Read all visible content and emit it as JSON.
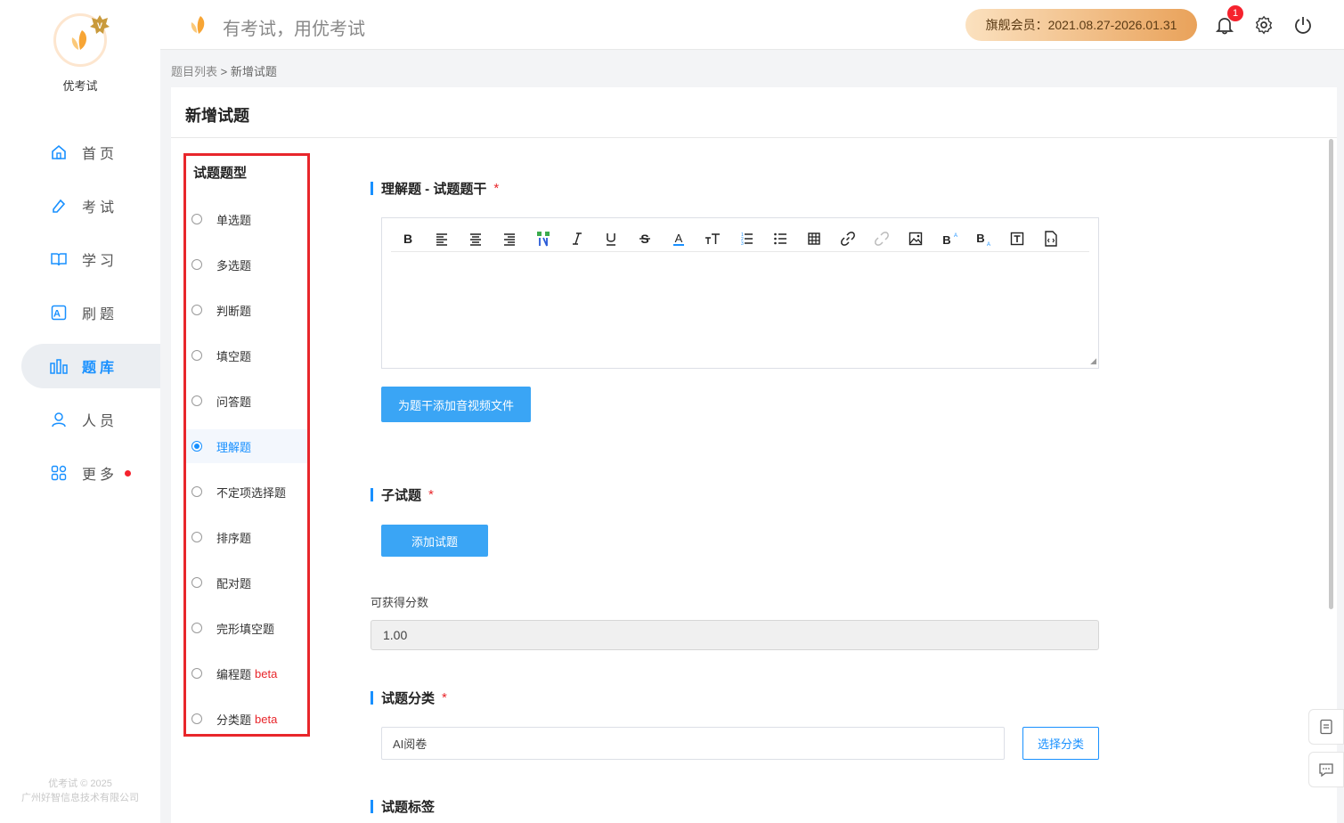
{
  "app": {
    "brand": "优考试",
    "slogan": "有考试，用优考试"
  },
  "nav": [
    {
      "label": "首页",
      "icon": "home-icon"
    },
    {
      "label": "考试",
      "icon": "pen-icon"
    },
    {
      "label": "学习",
      "icon": "book-icon"
    },
    {
      "label": "刷题",
      "icon": "letter-a-icon"
    },
    {
      "label": "题库",
      "icon": "chart-bars-icon",
      "active": true
    },
    {
      "label": "人员",
      "icon": "user-icon"
    },
    {
      "label": "更多",
      "icon": "apps-icon",
      "dot": true
    }
  ],
  "footer": {
    "line1": "优考试 © 2025",
    "line2": "广州好智信息技术有限公司"
  },
  "topbar": {
    "member": "旗舰会员：2021.08.27-2026.01.31",
    "notifications": "1"
  },
  "breadcrumb": {
    "parent": "题目列表",
    "sep": ">",
    "current": "新增试题"
  },
  "page": {
    "title": "新增试题"
  },
  "types": {
    "title": "试题题型",
    "options": [
      {
        "label": "单选题",
        "beta": ""
      },
      {
        "label": "多选题",
        "beta": ""
      },
      {
        "label": "判断题",
        "beta": ""
      },
      {
        "label": "填空题",
        "beta": ""
      },
      {
        "label": "问答题",
        "beta": ""
      },
      {
        "label": "理解题",
        "beta": "",
        "selected": true
      },
      {
        "label": "不定项选择题",
        "beta": ""
      },
      {
        "label": "排序题",
        "beta": ""
      },
      {
        "label": "配对题",
        "beta": ""
      },
      {
        "label": "完形填空题",
        "beta": ""
      },
      {
        "label": "编程题",
        "beta": "beta"
      },
      {
        "label": "分类题",
        "beta": "beta"
      }
    ]
  },
  "stem": {
    "title": "理解题 - 试题题干",
    "required": "*",
    "add_media": "为题干添加音视频文件"
  },
  "toolbar": [
    "bold",
    "align-left",
    "align-center",
    "align-right",
    "paint-format",
    "italic",
    "underline",
    "strikethrough",
    "font-color",
    "font-size",
    "ordered-list",
    "unordered-list",
    "table",
    "link",
    "unlink",
    "image",
    "superscript",
    "subscript",
    "text-box",
    "code-file"
  ],
  "sub": {
    "title": "子试题",
    "required": "*",
    "add": "添加试题"
  },
  "score": {
    "label": "可获得分数",
    "value": "1.00"
  },
  "category": {
    "title": "试题分类",
    "required": "*",
    "value": "AI阅卷",
    "choose": "选择分类"
  },
  "tags": {
    "title": "试题标签"
  },
  "colors": {
    "accent": "#1890ff",
    "danger": "#e8262b",
    "member_from": "#fbe1bf",
    "member_to": "#e9a25a"
  }
}
